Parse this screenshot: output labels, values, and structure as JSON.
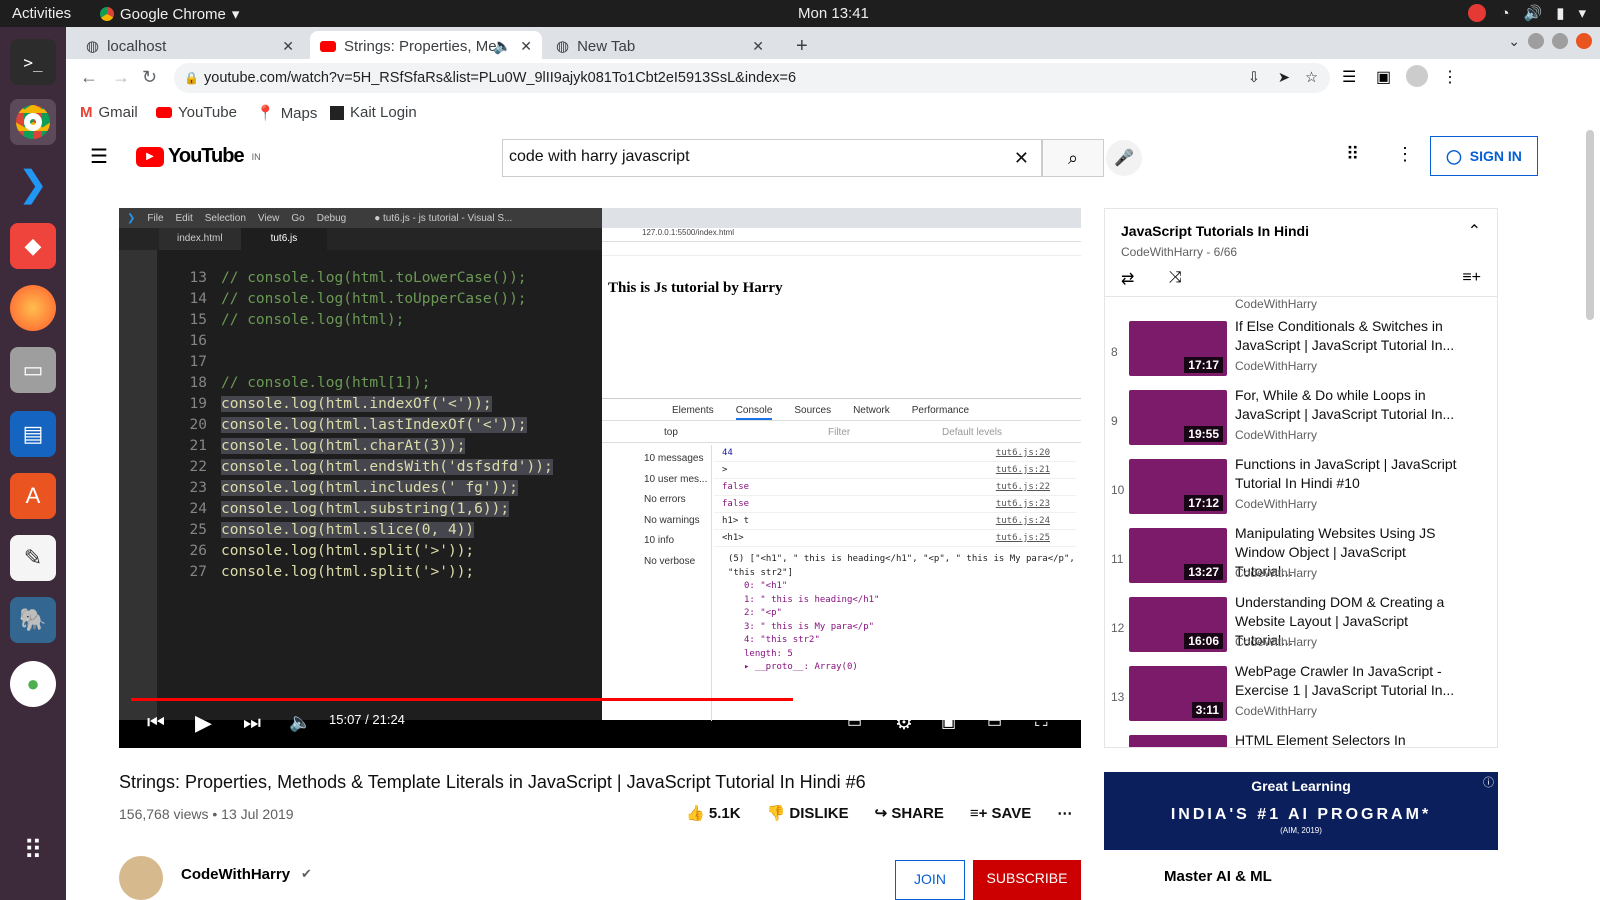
{
  "system": {
    "activities": "Activities",
    "app": "Google Chrome",
    "clock": "Mon 13:41"
  },
  "tabs": [
    {
      "label": "localhost"
    },
    {
      "label": "Strings: Properties, Me"
    },
    {
      "label": "New Tab"
    }
  ],
  "toolbar": {
    "url": "youtube.com/watch?v=5H_RSfSfaRs&list=PLu0W_9lII9ajyk081To1Cbt2eI5913SsL&index=6"
  },
  "bookmarks": [
    "Gmail",
    "YouTube",
    "Maps",
    "Kait Login"
  ],
  "youtube": {
    "logo": "YouTube",
    "region": "IN",
    "search_value": "code with harry javascript",
    "signin": "SIGN IN"
  },
  "video": {
    "title": "Strings: Properties, Methods & Template Literals in JavaScript | JavaScript Tutorial In Hindi #6",
    "views": "156,768 views • 13 Jul 2019",
    "time": "15:07 / 21:24",
    "progress": 0.706,
    "likes": "5.1K",
    "dislike": "DISLIKE",
    "share": "SHARE",
    "save": "SAVE"
  },
  "vscode": {
    "menu": [
      "File",
      "Edit",
      "Selection",
      "View",
      "Go",
      "Debug"
    ],
    "title": "● tut6.js - js tutorial - Visual S...",
    "tabs": [
      "index.html",
      "tut6.js"
    ],
    "lines": [
      {
        "n": "13",
        "t": "// console.log(html.toLowerCase());"
      },
      {
        "n": "14",
        "t": "// console.log(html.toUpperCase());"
      },
      {
        "n": "15",
        "t": "// console.log(html);"
      },
      {
        "n": "16",
        "t": ""
      },
      {
        "n": "17",
        "t": ""
      },
      {
        "n": "18",
        "t": "// console.log(html[1]);"
      },
      {
        "n": "19",
        "t": "console.log(html.indexOf('<'));"
      },
      {
        "n": "20",
        "t": "console.log(html.lastIndexOf('<'));"
      },
      {
        "n": "21",
        "t": "console.log(html.charAt(3));"
      },
      {
        "n": "22",
        "t": "console.log(html.endsWith('dsfsdfd'));"
      },
      {
        "n": "23",
        "t": "console.log(html.includes(' fg'));"
      },
      {
        "n": "24",
        "t": "console.log(html.substring(1,6));"
      },
      {
        "n": "25",
        "t": "console.log(html.slice(0, 4))"
      },
      {
        "n": "26",
        "t": "console.log(html.split('>'));"
      },
      {
        "n": "27",
        "t": "console.log(html.split('>'));"
      }
    ]
  },
  "inner_browser": {
    "heading": "This is Js tutorial by Harry",
    "url": "127.0.0.1:5500/index.html"
  },
  "devtools": {
    "tabs": [
      "Elements",
      "Console",
      "Sources",
      "Network",
      "Performance"
    ],
    "filter": "Filter",
    "context": "top",
    "levels": "Default levels",
    "sidebar": [
      "10 messages",
      "10 user mes...",
      "No errors",
      "No warnings",
      "10 info",
      "No verbose"
    ],
    "log": [
      {
        "v": "44",
        "s": "tut6.js:20"
      },
      {
        "v": ">",
        "s": "tut6.js:21"
      },
      {
        "v": "false",
        "s": "tut6.js:22"
      },
      {
        "v": "false",
        "s": "tut6.js:23"
      },
      {
        "v": "h1> t",
        "s": "tut6.js:24"
      },
      {
        "v": "<h1>",
        "s": "tut6.js:25"
      }
    ],
    "array": [
      "(5) [\"<h1\", \" this is heading</h1\", \"<p\", \" this is My para</p\", \"this str2\"]",
      "0: \"<h1\"",
      "1: \" this is heading</h1\"",
      "2: \"<p\"",
      "3: \" this is My para</p\"",
      "4: \"this str2\"",
      "length: 5",
      "▸ __proto__: Array(0)"
    ]
  },
  "playlist": {
    "title": "JavaScript Tutorials In Hindi",
    "sub": "CodeWithHarry - 6/66",
    "items": [
      {
        "n": "8",
        "title": "If Else Conditionals & Switches in JavaScript | JavaScript Tutorial In...",
        "channel": "CodeWithHarry",
        "dur": "17:17"
      },
      {
        "n": "9",
        "title": "For, While & Do while Loops in JavaScript | JavaScript Tutorial In...",
        "channel": "CodeWithHarry",
        "dur": "19:55"
      },
      {
        "n": "10",
        "title": "Functions in JavaScript | JavaScript Tutorial In Hindi #10",
        "channel": "CodeWithHarry",
        "dur": "17:12"
      },
      {
        "n": "11",
        "title": "Manipulating Websites Using JS Window Object | JavaScript Tutorial...",
        "channel": "CodeWithHarry",
        "dur": "13:27"
      },
      {
        "n": "12",
        "title": "Understanding DOM & Creating a Website Layout | JavaScript Tutorial...",
        "channel": "CodeWithHarry",
        "dur": "16:06"
      },
      {
        "n": "13",
        "title": "WebPage Crawler In JavaScript - Exercise 1 | JavaScript Tutorial In...",
        "channel": "CodeWithHarry",
        "dur": "3:11"
      },
      {
        "n": "",
        "title": "HTML Element Selectors In",
        "channel": "",
        "dur": ""
      }
    ],
    "prev_channel": "CodeWithHarry"
  },
  "ad": {
    "brand": "Great Learning",
    "text": "INDIA'S #1 AI PROGRAM*",
    "sub": "(AIM, 2019)",
    "next": "Master AI & ML"
  },
  "channel": {
    "name": "CodeWithHarry",
    "join": "JOIN",
    "subscribe": "SUBSCRIBE"
  }
}
